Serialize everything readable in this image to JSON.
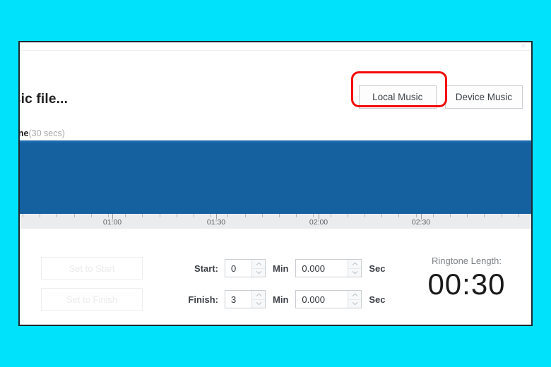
{
  "window": {
    "close_icon": "×"
  },
  "header": {
    "title": "music file...",
    "tone_name": "ext Tone",
    "tone_duration": "(30 secs)"
  },
  "source_buttons": [
    {
      "label": "Local Music",
      "name": "local-music-button",
      "highlighted": true
    },
    {
      "label": "Device Music",
      "name": "device-music-button",
      "highlighted": false
    }
  ],
  "annotation": {
    "color": "#f40a0a",
    "target": "Local Music"
  },
  "waveform": {
    "color": "#15609f"
  },
  "timeline": {
    "labels": [
      "01:00",
      "01:30",
      "02:00",
      "02:30"
    ]
  },
  "controls": {
    "set_to_start_label": "Set to Start",
    "set_to_finish_label": "Set to Finish",
    "start_label": "Start:",
    "finish_label": "Finish:",
    "min_unit": "Min",
    "sec_unit": "Sec",
    "start_min": "0",
    "start_sec": "0.000",
    "finish_min": "3",
    "finish_sec": "0.000",
    "spin_up_icon": "⌃",
    "spin_down_icon": "⌄"
  },
  "ringtone": {
    "length_label": "Ringtone Length:",
    "length_value": "00:30"
  },
  "faint_strip": {
    "text": " "
  }
}
